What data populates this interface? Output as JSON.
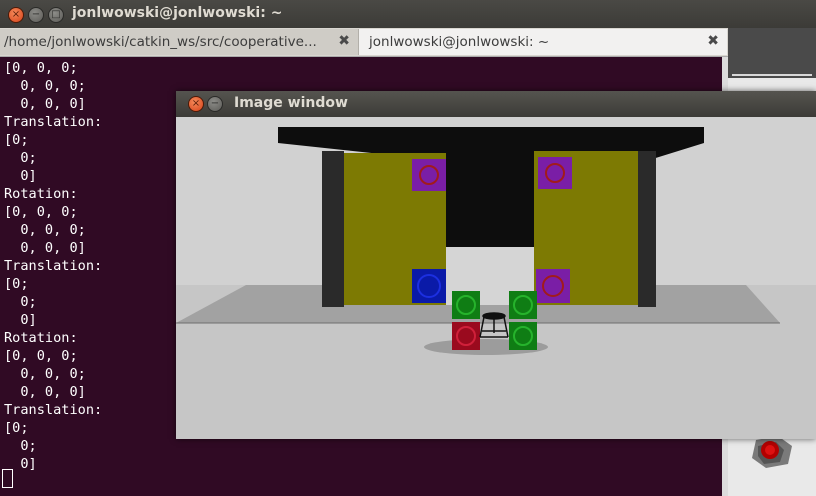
{
  "terminal": {
    "window_title": "jonlwowski@jonlwowski: ~",
    "tabs": [
      {
        "label": "/home/jonlwowski/catkin_ws/src/cooperative..."
      },
      {
        "label": "jonlwowski@jonlwowski: ~"
      }
    ],
    "tab_close_glyph": "✖",
    "output": "[0, 0, 0;\n  0, 0, 0;\n  0, 0, 0]\nTranslation:\n[0;\n  0;\n  0]\nRotation:\n[0, 0, 0;\n  0, 0, 0;\n  0, 0, 0]\nTranslation:\n[0;\n  0;\n  0]\nRotation:\n[0, 0, 0;\n  0, 0, 0;\n  0, 0, 0]\nTranslation:\n[0;\n  0;\n  0]"
  },
  "image_window": {
    "title": "Image window"
  },
  "window_buttons": {
    "close_glyph": "×",
    "minimize_glyph": "−",
    "maximize_glyph": "□"
  },
  "colors": {
    "terminal_bg": "#300a24",
    "terminal_fg": "#ffffff",
    "titlebar": "#3c3b37",
    "close_button": "#e05a2a",
    "wall_olive": "#7d7a03",
    "marker_purple": "#7a1ea6",
    "marker_blue": "#0a1aa8",
    "marker_green": "#0f7d14",
    "marker_red": "#9a0a1e"
  },
  "icons": {
    "close": "close-icon",
    "minimize": "minimize-icon",
    "maximize": "maximize-icon",
    "tab_close": "tab-close-icon"
  }
}
